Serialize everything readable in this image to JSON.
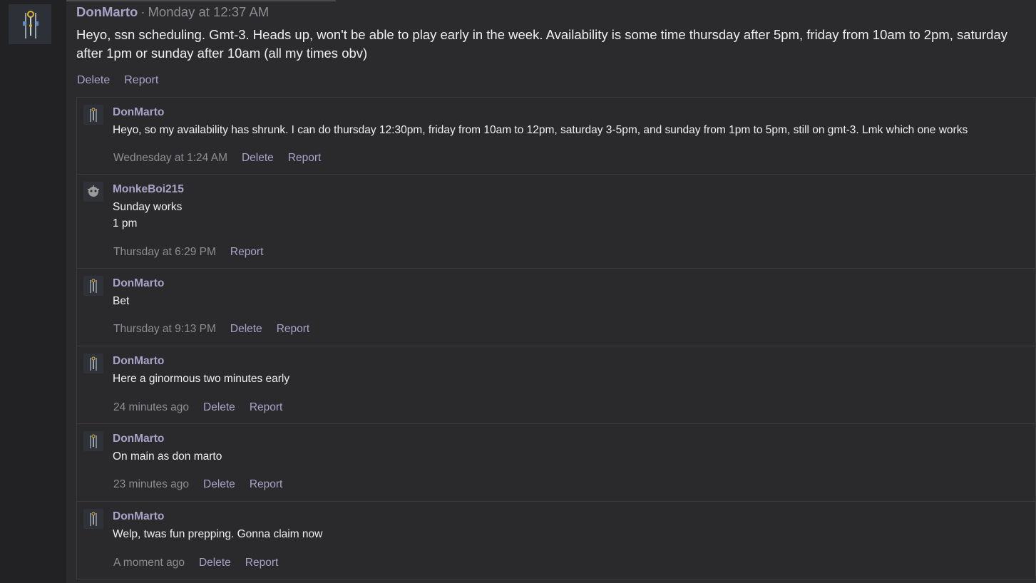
{
  "status": {
    "author": "DonMarto",
    "separator": "·",
    "time": "Monday at 12:37 AM",
    "text": "Heyo, ssn scheduling. Gmt-3. Heads up, won't be able to play early in the week. Availability is some time thursday after 5pm, friday from 10am to 2pm, saturday after 1pm or sunday after 10am (all my times obv)",
    "delete_label": "Delete",
    "report_label": "Report",
    "avatar_icon": "character-avatar-icon"
  },
  "comments": [
    {
      "author": "DonMarto",
      "lines": [
        "Heyo, so my availability has shrunk. I can do thursday 12:30pm, friday from 10am to 12pm, saturday 3-5pm, and sunday from 1pm to 5pm, still on gmt-3. Lmk which one works"
      ],
      "time": "Wednesday at 1:24 AM",
      "delete_label": "Delete",
      "report_label": "Report"
    },
    {
      "author": "MonkeBoi215",
      "lines": [
        "Sunday works",
        "1 pm"
      ],
      "time": "Thursday at 6:29 PM",
      "report_label": "Report"
    },
    {
      "author": "DonMarto",
      "lines": [
        "Bet"
      ],
      "time": "Thursday at 9:13 PM",
      "delete_label": "Delete",
      "report_label": "Report"
    },
    {
      "author": "DonMarto",
      "lines": [
        "Here a ginormous two minutes early"
      ],
      "time": "24 minutes ago",
      "delete_label": "Delete",
      "report_label": "Report"
    },
    {
      "author": "DonMarto",
      "lines": [
        "On main as don marto"
      ],
      "time": "23 minutes ago",
      "delete_label": "Delete",
      "report_label": "Report"
    },
    {
      "author": "DonMarto",
      "lines": [
        "Welp, twas fun prepping. Gonna claim now"
      ],
      "time": "A moment ago",
      "delete_label": "Delete",
      "report_label": "Report"
    }
  ],
  "colors": {
    "accent": "#a9a3c9",
    "muted": "#8e8e92",
    "panel": "#2b2b2d"
  }
}
